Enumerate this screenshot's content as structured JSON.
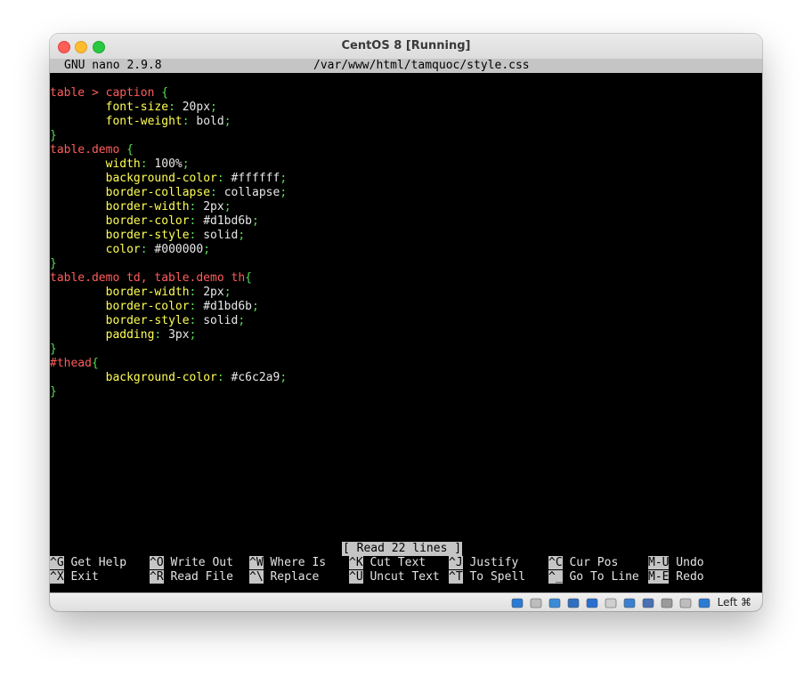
{
  "window": {
    "title": "CentOS 8 [Running]"
  },
  "nano": {
    "version": "GNU nano 2.9.8",
    "filename": "/var/www/html/tamquoc/style.css",
    "status_message": "[ Read 22 lines ]"
  },
  "code_lines": [
    [
      "table > caption",
      " {"
    ],
    [
      "font-size",
      ": ",
      "20px",
      ";"
    ],
    [
      "font-weight",
      ": ",
      "bold",
      ";"
    ],
    [
      "}"
    ],
    [
      "table.demo",
      " {"
    ],
    [
      "width",
      ": ",
      "100%",
      ";"
    ],
    [
      "background-color",
      ": ",
      "#ffffff",
      ";"
    ],
    [
      "border-collapse",
      ": ",
      "collapse",
      ";"
    ],
    [
      "border-width",
      ": ",
      "2px",
      ";"
    ],
    [
      "border-color",
      ": ",
      "#d1bd6b",
      ";"
    ],
    [
      "border-style",
      ": ",
      "solid",
      ";"
    ],
    [
      "color",
      ": ",
      "#000000",
      ";"
    ],
    [
      "}"
    ],
    [
      "table.demo td, table.demo th",
      "{"
    ],
    [
      "border-width",
      ": ",
      "2px",
      ";"
    ],
    [
      "border-color",
      ": ",
      "#d1bd6b",
      ";"
    ],
    [
      "border-style",
      ": ",
      "solid",
      ";"
    ],
    [
      "padding",
      ": ",
      "3px",
      ";"
    ],
    [
      "}"
    ],
    [
      "#thead",
      "{"
    ],
    [
      "background-color",
      ": ",
      "#c6c2a9",
      ";"
    ],
    [
      "}"
    ]
  ],
  "shortcuts_row1": [
    {
      "key": "^G",
      "label": "Get Help"
    },
    {
      "key": "^O",
      "label": "Write Out"
    },
    {
      "key": "^W",
      "label": "Where Is"
    },
    {
      "key": "^K",
      "label": "Cut Text"
    },
    {
      "key": "^J",
      "label": "Justify"
    },
    {
      "key": "^C",
      "label": "Cur Pos"
    },
    {
      "key": "M-U",
      "label": "Undo"
    }
  ],
  "shortcuts_row2": [
    {
      "key": "^X",
      "label": "Exit"
    },
    {
      "key": "^R",
      "label": "Read File"
    },
    {
      "key": "^\\",
      "label": "Replace"
    },
    {
      "key": "^U",
      "label": "Uncut Text"
    },
    {
      "key": "^T",
      "label": "To Spell"
    },
    {
      "key": "^_",
      "label": "Go To Line"
    },
    {
      "key": "M-E",
      "label": "Redo"
    }
  ],
  "statusbar": {
    "host_key": "Left ⌘",
    "icons": [
      "hard-disk-icon",
      "optical-drive-icon",
      "audio-icon",
      "network-icon",
      "usb-icon",
      "shared-folder-icon",
      "display-icon",
      "recording-icon",
      "cpu-icon",
      "mouse-integration-icon",
      "keyboard-icon"
    ]
  },
  "colors": {
    "selector": "#ff5c5c",
    "property": "#ffff55",
    "brace": "#55dd55",
    "terminal_bg": "#000000",
    "nano_bar": "#c5c5c5"
  }
}
